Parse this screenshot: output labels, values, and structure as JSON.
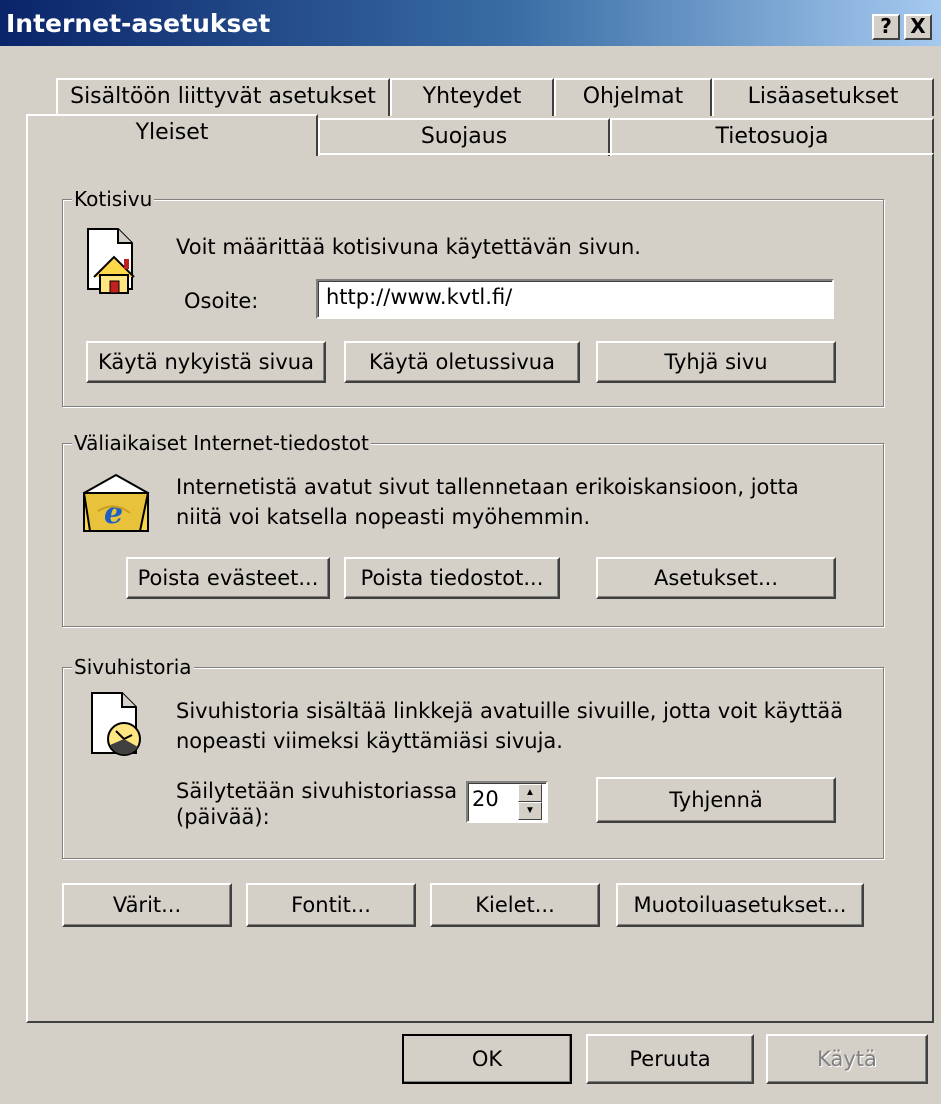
{
  "window": {
    "title": "Internet-asetukset",
    "help_button": "?",
    "close_button": "X"
  },
  "tabs_back": [
    "Sisältöön liittyvät asetukset",
    "Yhteydet",
    "Ohjelmat",
    "Lisäasetukset"
  ],
  "tabs_front": [
    "Yleiset",
    "Suojaus",
    "Tietosuoja"
  ],
  "active_tab": "Yleiset",
  "homepage": {
    "label": "Kotisivu",
    "description": "Voit määrittää kotisivuna käytettävän sivun.",
    "address_label": "Osoite:",
    "address_value": "http://www.kvtl.fi/",
    "buttons": [
      "Käytä nykyistä sivua",
      "Käytä oletussivua",
      "Tyhjä sivu"
    ]
  },
  "temp_files": {
    "label": "Väliaikaiset Internet-tiedostot",
    "description_line1": "Internetistä avatut sivut tallennetaan erikoiskansioon, jotta",
    "description_line2": "niitä voi katsella nopeasti myöhemmin.",
    "buttons": [
      "Poista evästeet...",
      "Poista tiedostot...",
      "Asetukset..."
    ]
  },
  "history": {
    "label": "Sivuhistoria",
    "description_line1": "Sivuhistoria sisältää linkkejä avatuille sivuille, jotta voit käyttää",
    "description_line2": "nopeasti viimeksi käyttämiäsi sivuja.",
    "days_label_line1": "Säilytetään sivuhistoriassa",
    "days_label_line2": "(päivää):",
    "days_value": "20",
    "clear_button": "Tyhjennä"
  },
  "bottom_buttons": [
    "Värit...",
    "Fontit...",
    "Kielet...",
    "Muotoiluasetukset..."
  ],
  "dialog_buttons": {
    "ok": "OK",
    "cancel": "Peruuta",
    "apply": "Käytä"
  }
}
